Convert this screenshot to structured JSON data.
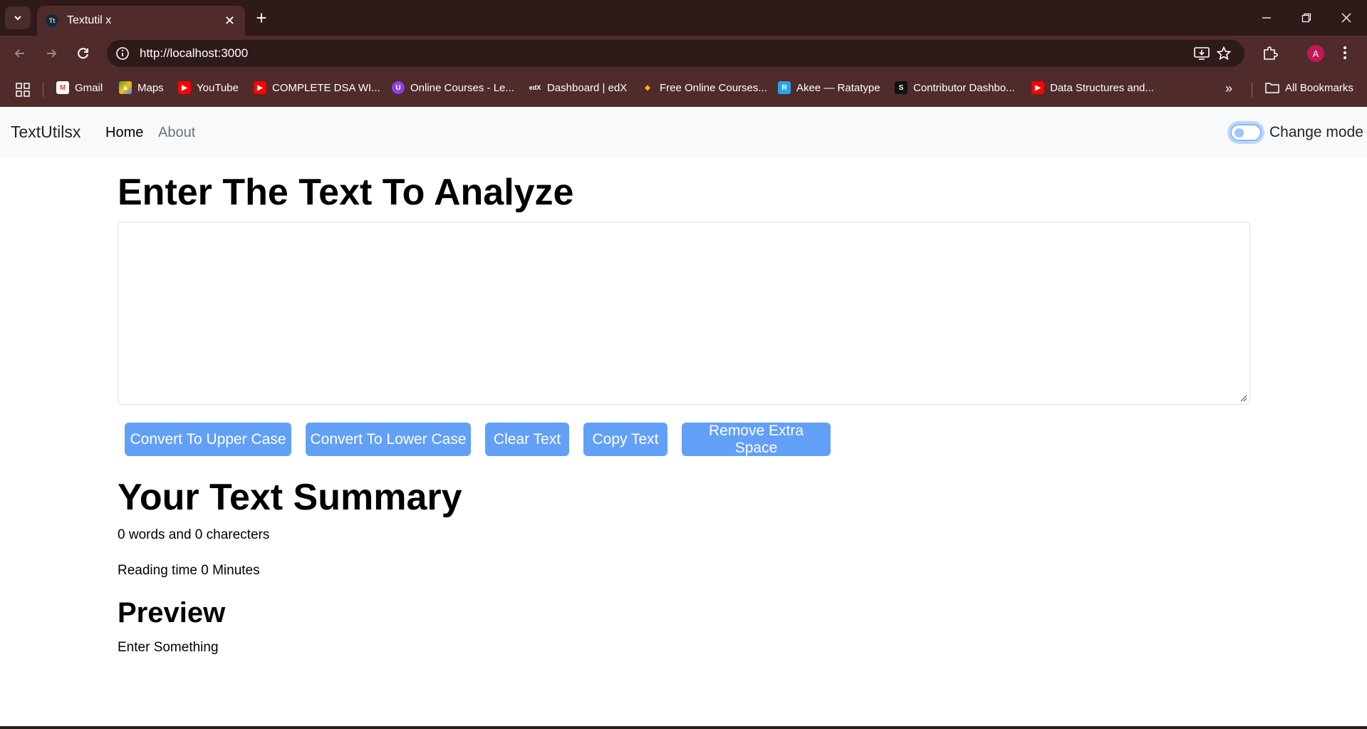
{
  "browser": {
    "tab": {
      "title": "Textutil x",
      "favicon": "Tt"
    },
    "url": "http://localhost:3000",
    "profile_initial": "A",
    "bookmarks": [
      {
        "label": "Gmail",
        "icon": "gmail-icon"
      },
      {
        "label": "Maps",
        "icon": "maps-icon"
      },
      {
        "label": "YouTube",
        "icon": "youtube-icon"
      },
      {
        "label": "COMPLETE DSA WI...",
        "icon": "youtube-icon"
      },
      {
        "label": "Online Courses - Le...",
        "icon": "udemy-icon"
      },
      {
        "label": "Dashboard | edX",
        "icon": "edx-icon"
      },
      {
        "label": "Free Online Courses...",
        "icon": "coursera-icon"
      },
      {
        "label": "Akee — Ratatype",
        "icon": "ratatype-icon"
      },
      {
        "label": "Contributor Dashbo...",
        "icon": "contributor-icon"
      },
      {
        "label": "Data Structures and...",
        "icon": "youtube-icon"
      }
    ],
    "all_bookmarks": "All Bookmarks"
  },
  "navbar": {
    "brand": "TextUtilsx",
    "links": [
      "Home",
      "About"
    ],
    "mode_label": "Change mode",
    "mode_toggle_on": false
  },
  "main": {
    "heading": "Enter The Text To Analyze",
    "textarea_value": "",
    "buttons": [
      "Convert To Upper Case",
      "Convert To Lower Case",
      "Clear Text",
      "Copy Text",
      "Remove Extra Space"
    ]
  },
  "summary": {
    "heading": "Your Text Summary",
    "counts": "0 words and 0 charecters",
    "reading_time": "Reading time 0 Minutes"
  },
  "preview": {
    "heading": "Preview",
    "text": "Enter Something"
  },
  "colors": {
    "chrome_dark": "#2f1a1a",
    "chrome_mid": "#4f2b2b",
    "button_primary": "#62a0f8",
    "navbar_bg": "#f8f9fa"
  }
}
